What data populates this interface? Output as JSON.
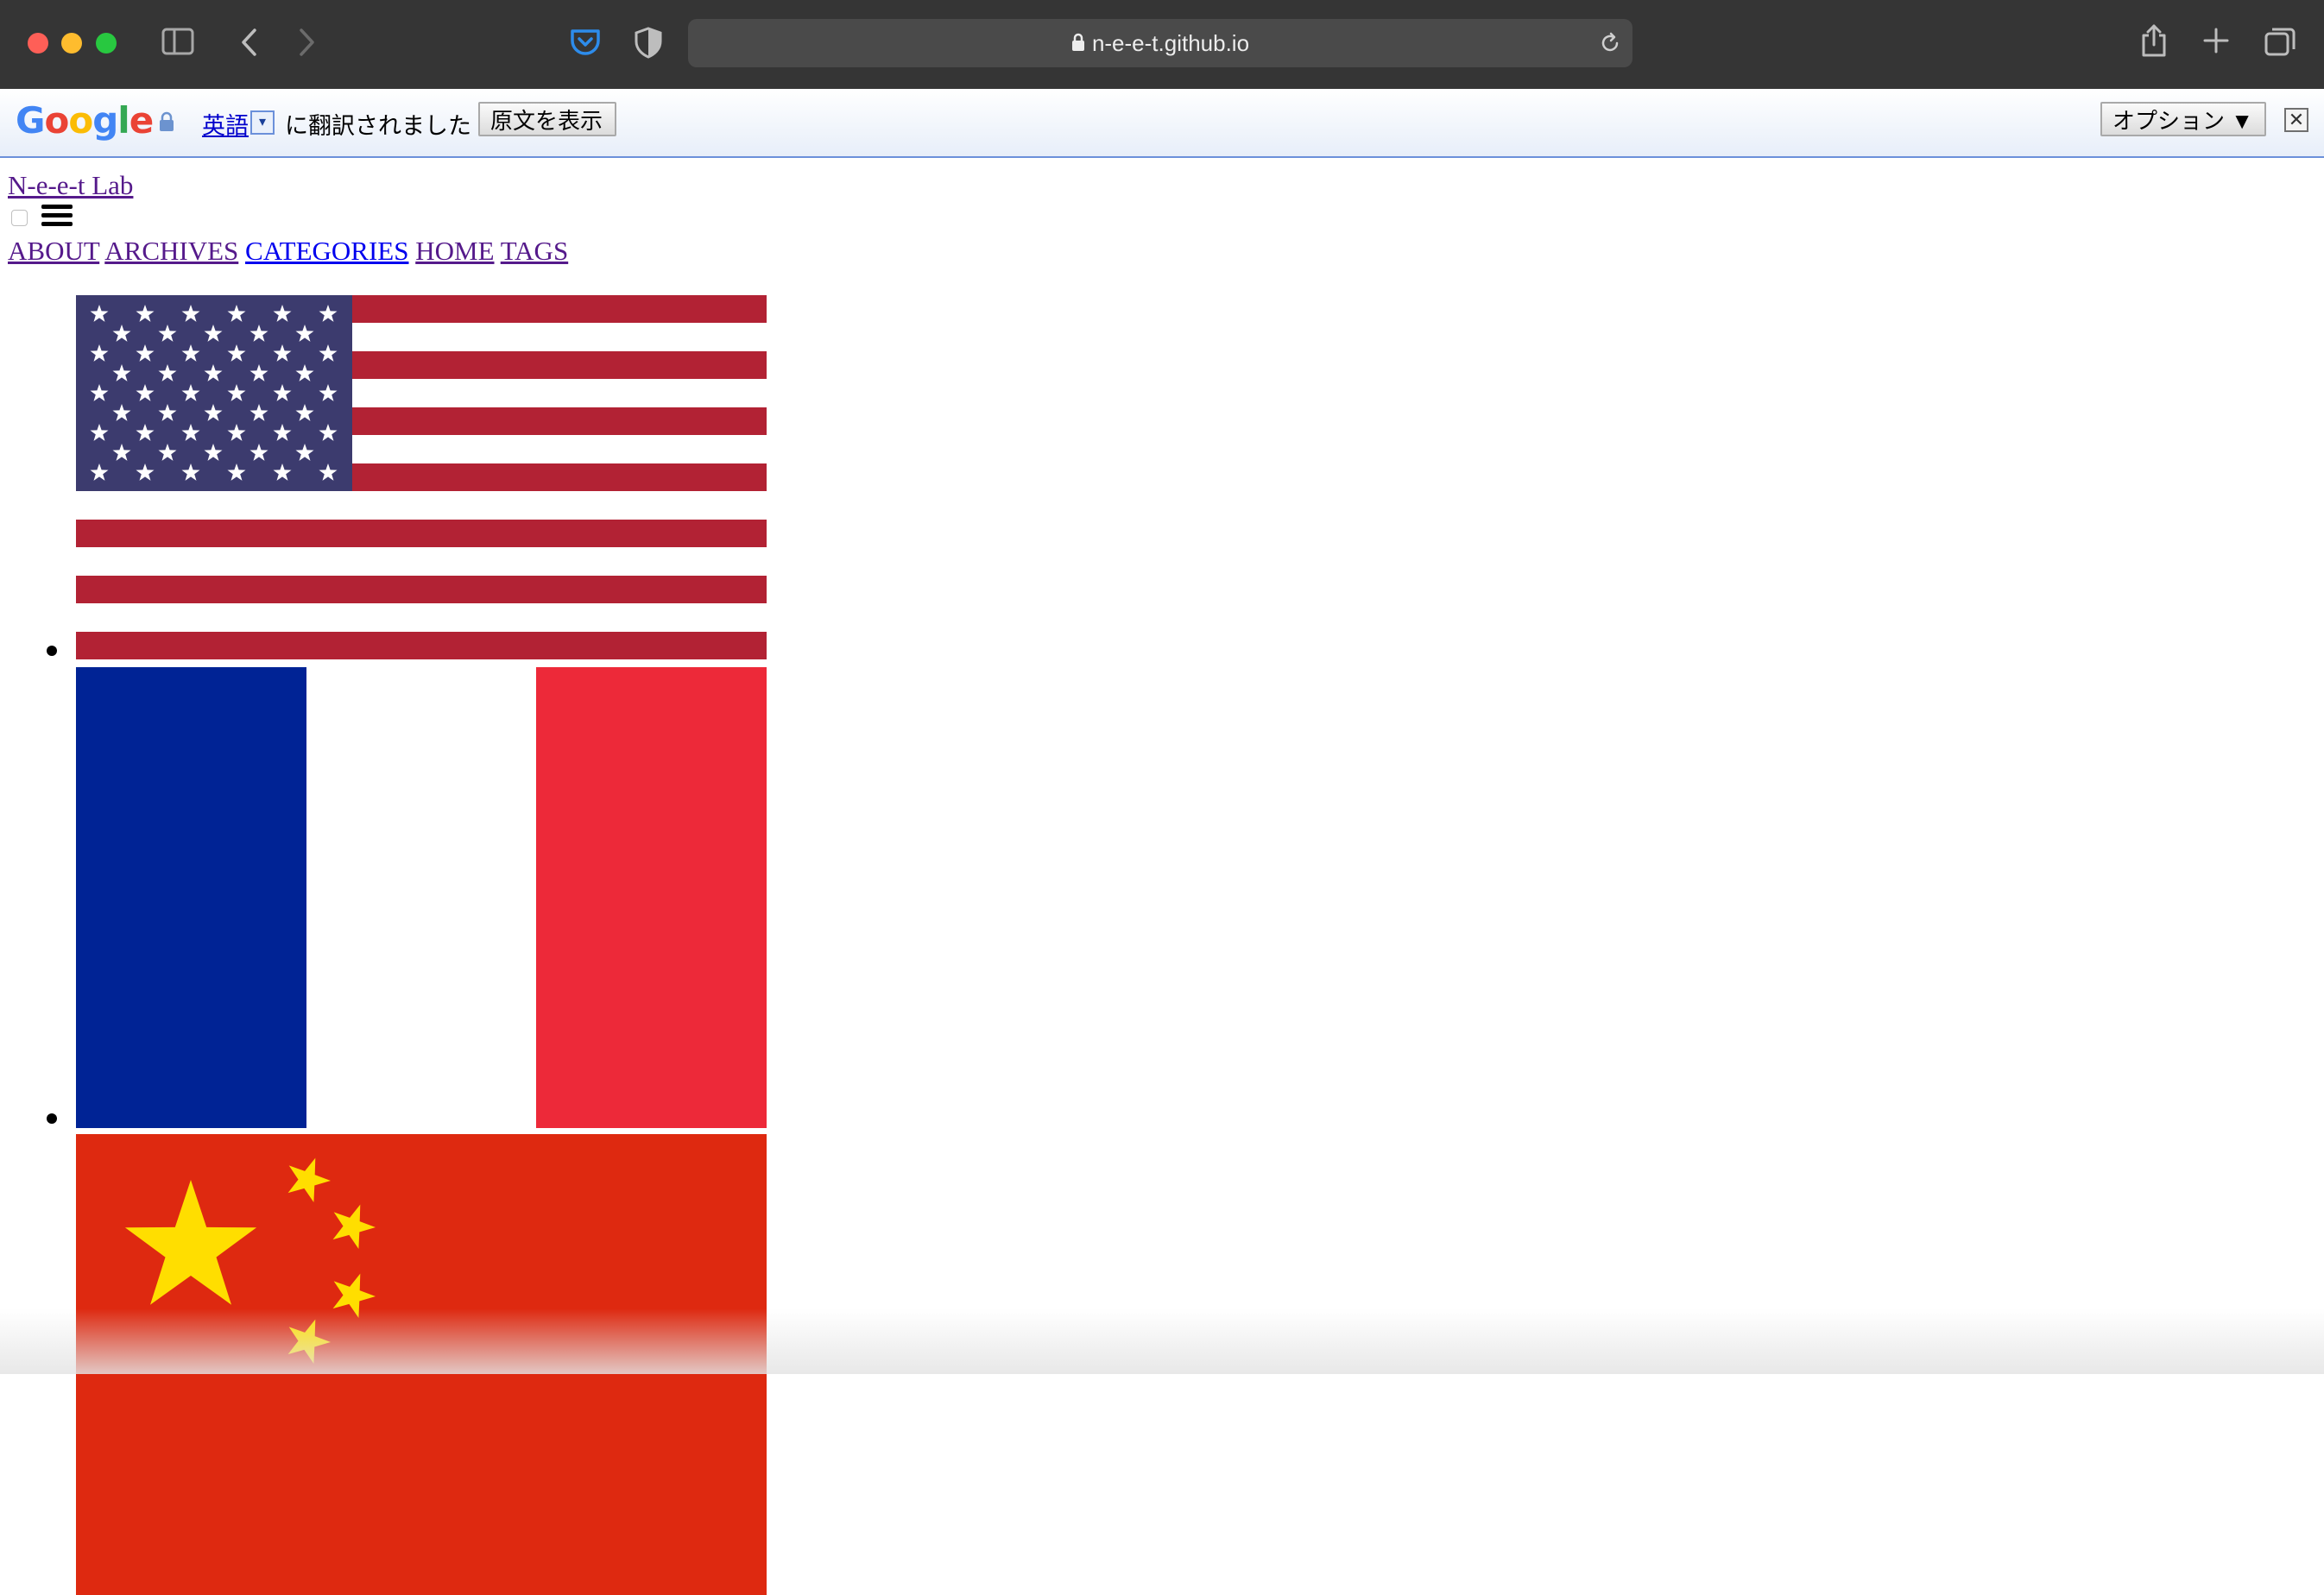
{
  "browser": {
    "url": "n-e-e-t.github.io",
    "icons": [
      "sidebar-icon",
      "back-icon",
      "forward-icon",
      "pocket-icon",
      "privacy-shield-icon",
      "lock-icon",
      "reload-icon",
      "share-icon",
      "new-tab-icon",
      "tab-overview-icon"
    ]
  },
  "translate_bar": {
    "logo": "Google",
    "language": "英語",
    "dropdown_glyph": "▾",
    "translated_text": "に翻訳されました",
    "show_original_label": "原文を表示",
    "options_label": "オプション ▼",
    "close_glyph": "✕"
  },
  "site": {
    "title": "N-e-e-t Lab",
    "nav": [
      "ABOUT",
      "ARCHIVES",
      "CATEGORIES",
      "HOME",
      "TAGS"
    ]
  },
  "languages": [
    {
      "flag": "united-states-flag"
    },
    {
      "flag": "france-flag"
    },
    {
      "flag": "china-flag"
    }
  ],
  "colors": {
    "toolbar": "#353535",
    "link_visited": "#551a8b",
    "link_unvisited": "#0000ee",
    "us_red": "#b22234",
    "us_blue": "#3c3b6e",
    "fr_blue": "#002395",
    "fr_red": "#ed2939",
    "cn_red": "#de2910",
    "cn_yellow": "#ffde00"
  }
}
